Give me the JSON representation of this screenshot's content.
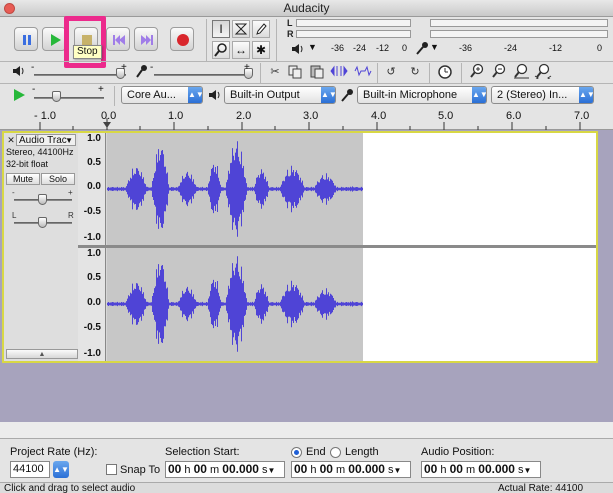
{
  "window": {
    "title": "Audacity"
  },
  "colors": {
    "wave": "#4f44d6",
    "accent": "#ec2a8c",
    "track_border": "#d8d845"
  },
  "transport": {
    "pause_icon": "pause-icon",
    "play_icon": "play-icon",
    "stop_icon": "stop-icon",
    "skip_start_icon": "skip-to-start-icon",
    "skip_end_icon": "skip-to-end-icon",
    "record_icon": "record-icon",
    "stop_tooltip": "Stop"
  },
  "meters": {
    "left_label": "L",
    "right_label": "R",
    "play_ticks": [
      "-36",
      "-24",
      "-12",
      "0"
    ],
    "rec_ticks": [
      "-36",
      "-24",
      "-12",
      "0"
    ]
  },
  "mixer": {
    "minus": "-",
    "plus": "+"
  },
  "device_bar": {
    "host": "Core Au...",
    "output": "Built-in Output",
    "input": "Built-in Microphone",
    "channels": "2 (Stereo) In..."
  },
  "ruler": {
    "labels": [
      "- 1.0",
      "0.0",
      "1.0",
      "2.0",
      "3.0",
      "4.0",
      "5.0",
      "6.0",
      "7.0"
    ]
  },
  "track": {
    "name": "Audio Trac",
    "info1": "Stereo, 44100Hz",
    "info2": "32-bit float",
    "mute": "Mute",
    "solo": "Solo",
    "gain_minus": "-",
    "gain_plus": "+",
    "pan_left": "L",
    "pan_right": "R",
    "vruler_top": [
      "1.0",
      "0.5",
      "0.0",
      "-0.5",
      "-1.0"
    ],
    "vruler_bottom": [
      "1.0",
      "0.5",
      "0.0",
      "-0.5",
      "-1.0"
    ]
  },
  "bottom": {
    "project_rate_label": "Project Rate (Hz):",
    "project_rate_value": "44100",
    "snap_to_label": "Snap To",
    "selection_start_label": "Selection Start:",
    "end_label": "End",
    "length_label": "Length",
    "audio_position_label": "Audio Position:",
    "time_h": "00",
    "time_m": "00",
    "time_s": "00.000",
    "unit_h": "h",
    "unit_m": "m",
    "unit_s": "s"
  },
  "status": {
    "left": "Click and drag to select audio",
    "right": "Actual Rate: 44100"
  }
}
